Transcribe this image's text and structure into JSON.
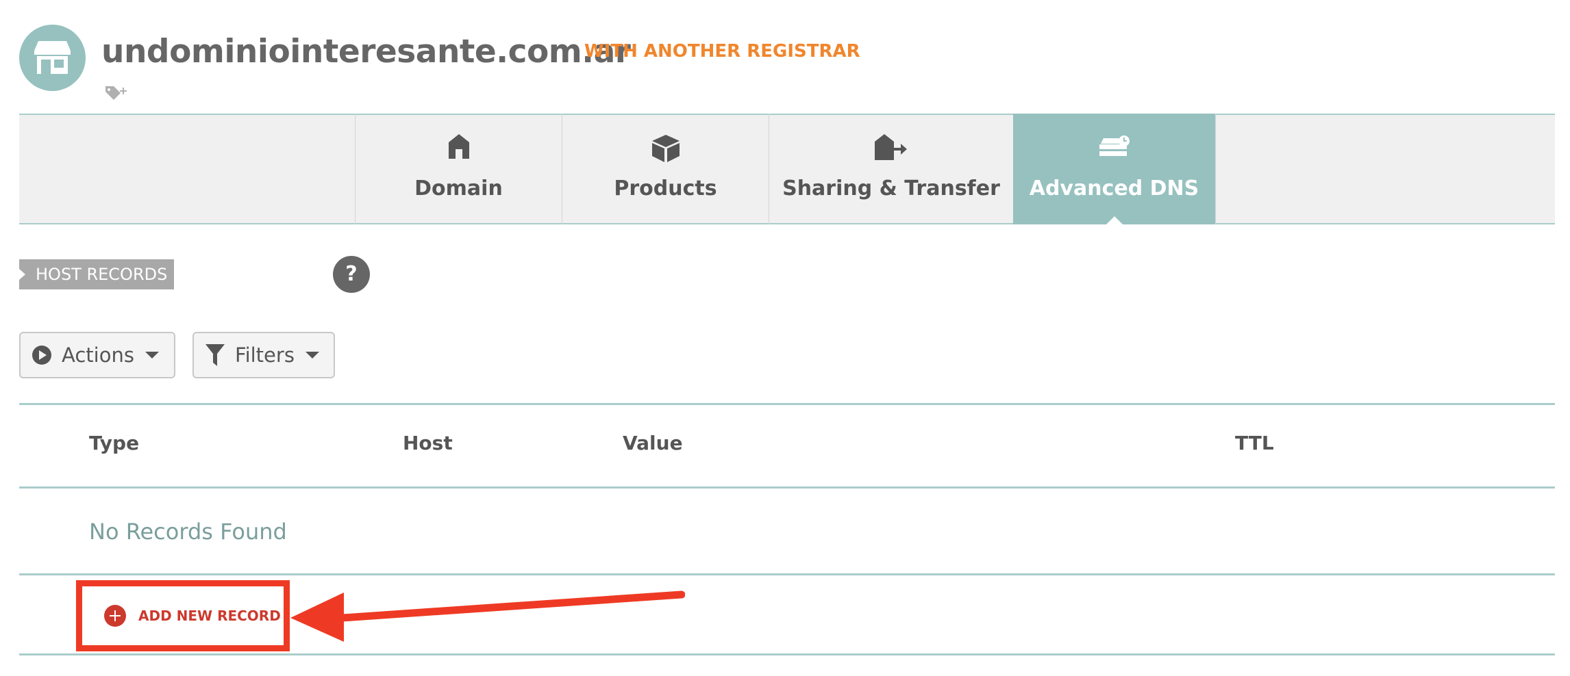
{
  "header": {
    "domain": "undominiointeresante.com.ar",
    "registrar_badge": "WITH ANOTHER REGISTRAR",
    "avatar_icon": "storefront-icon",
    "tag_icon": "tag-add-icon"
  },
  "tabs": [
    {
      "label": "Domain",
      "icon": "home-icon",
      "active": false
    },
    {
      "label": "Products",
      "icon": "box-icon",
      "active": false
    },
    {
      "label": "Sharing & Transfer",
      "icon": "house-arrow-icon",
      "active": false
    },
    {
      "label": "Advanced DNS",
      "icon": "server-icon",
      "active": true
    }
  ],
  "section": {
    "label": "HOST RECORDS",
    "help": "?"
  },
  "toolbar": {
    "actions_label": "Actions",
    "filters_label": "Filters"
  },
  "table": {
    "columns": [
      "Type",
      "Host",
      "Value",
      "TTL"
    ],
    "empty_message": "No Records Found"
  },
  "add_record": {
    "label": "ADD NEW RECORD"
  },
  "colors": {
    "accent": "#96c1bf",
    "registrar": "#f0862d",
    "annotation": "#ee3a24",
    "add": "#cc3a2e"
  }
}
